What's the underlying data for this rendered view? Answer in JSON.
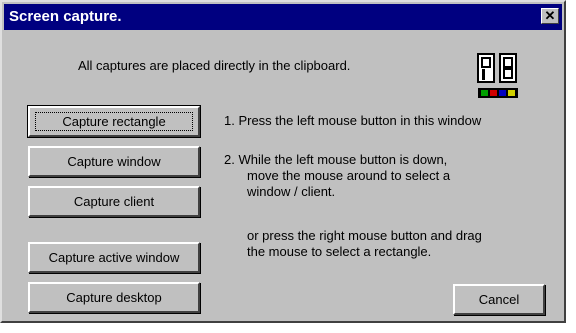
{
  "window": {
    "title": "Screen capture."
  },
  "intro": "All captures are placed directly in the clipboard.",
  "buttons": {
    "rect": "Capture rectangle",
    "window": "Capture window",
    "client": "Capture client",
    "active": "Capture active window",
    "desktop": "Capture desktop",
    "cancel": "Cancel"
  },
  "instructions": {
    "step1": "1.  Press the left mouse button in this window",
    "step2_l1": "2.  While the left mouse button is down,",
    "step2_l2": "move the mouse around to select a",
    "step2_l3": "window / client.",
    "alt_l1": "or press the right mouse button and drag",
    "alt_l2": "the mouse to select a rectangle."
  },
  "icons": {
    "close": "close-icon",
    "logo": "app-logo-icon"
  },
  "colors": {
    "titlebar": "#000080",
    "face": "#c0c0c0"
  }
}
